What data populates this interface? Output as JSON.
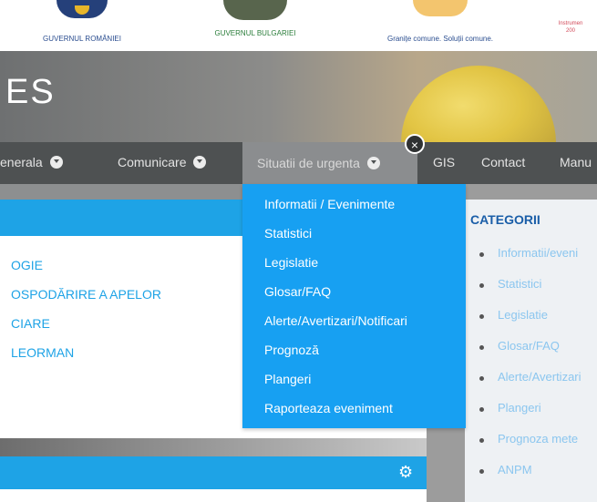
{
  "logos": {
    "romania": "GUVERNUL ROMÂNIEI",
    "bulgaria": "GUVERNUL BULGARIEI",
    "program": "Granițe comune. Soluții comune.",
    "instrument": "Instrumen\n200"
  },
  "hero": {
    "title": "ES"
  },
  "nav": {
    "items": [
      "enerala",
      "Comunicare",
      "Situatii de urgenta",
      "GIS",
      "Contact",
      "Manu"
    ],
    "close_symbol": "×"
  },
  "dropdown": {
    "items": [
      "Informatii / Evenimente",
      "Statistici",
      "Legislatie",
      "Glosar/FAQ",
      "Alerte/Avertizari/Notificari",
      "Prognoză",
      "Plangeri",
      "Raporteaza eveniment"
    ]
  },
  "left_links": [
    "OGIE",
    "OSPODĂRIRE A APELOR",
    "CIARE",
    "LEORMAN"
  ],
  "sidebar": {
    "title": "CATEGORII",
    "items": [
      "Informatii/eveni",
      "Statistici",
      "Legislatie",
      "Glosar/FAQ",
      "Alerte/Avertizari",
      "Plangeri",
      "Prognoza mete",
      "ANPM"
    ]
  },
  "colors": {
    "accent": "#1ea3e6",
    "dropdown": "#17a0f2",
    "nav": "#4e5152",
    "category_title": "#1a5ea8"
  }
}
